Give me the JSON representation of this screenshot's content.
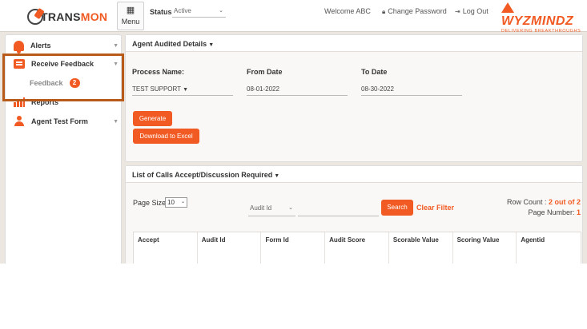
{
  "header": {
    "logo_text_a": "TRANS",
    "logo_text_b": "MON",
    "menu_icon": "grid-icon",
    "menu_label": "Menu",
    "status_label": "Status",
    "status_value": "Active",
    "welcome": "Welcome ABC",
    "change_password": "Change Password",
    "log_out": "Log Out",
    "brand_name": "WYZMINDZ",
    "brand_tagline": "DELIVERING BREAKTHROUGHS"
  },
  "sidebar": {
    "items": [
      {
        "label": "Alerts",
        "icon": "bell-icon"
      },
      {
        "label": "Receive Feedback",
        "icon": "feedback-icon"
      },
      {
        "label": "Reports",
        "icon": "bar-chart-icon"
      },
      {
        "label": "Agent Test Form",
        "icon": "person-icon"
      }
    ],
    "sub_item": {
      "label": "Feedback",
      "badge": "2"
    }
  },
  "agent_audited": {
    "title": "Agent Audited Details",
    "process_label": "Process Name:",
    "process_value": "TEST SUPPORT",
    "from_label": "From Date",
    "from_value": "08-01-2022",
    "to_label": "To Date",
    "to_value": "08-30-2022",
    "generate": "Generate",
    "download": "Download to Excel"
  },
  "calls_list": {
    "title": "List of Calls Accept/Discussion Required",
    "page_size_label": "Page Size",
    "page_size_value": "10",
    "filter_select": "Audit Id",
    "search": "Search",
    "clear_filter": "Clear Filter",
    "row_count_label": "Row Count :",
    "row_count_value": "2 out of 2",
    "page_number_label": "Page Number:",
    "page_number_value": "1",
    "columns": [
      "Accept",
      "Audit Id",
      "Form Id",
      "Audit Score",
      "Scorable Value",
      "Scoring Value",
      "Agentid"
    ]
  },
  "colors": {
    "accent": "#f15a22",
    "highlight": "#b85b1a"
  }
}
